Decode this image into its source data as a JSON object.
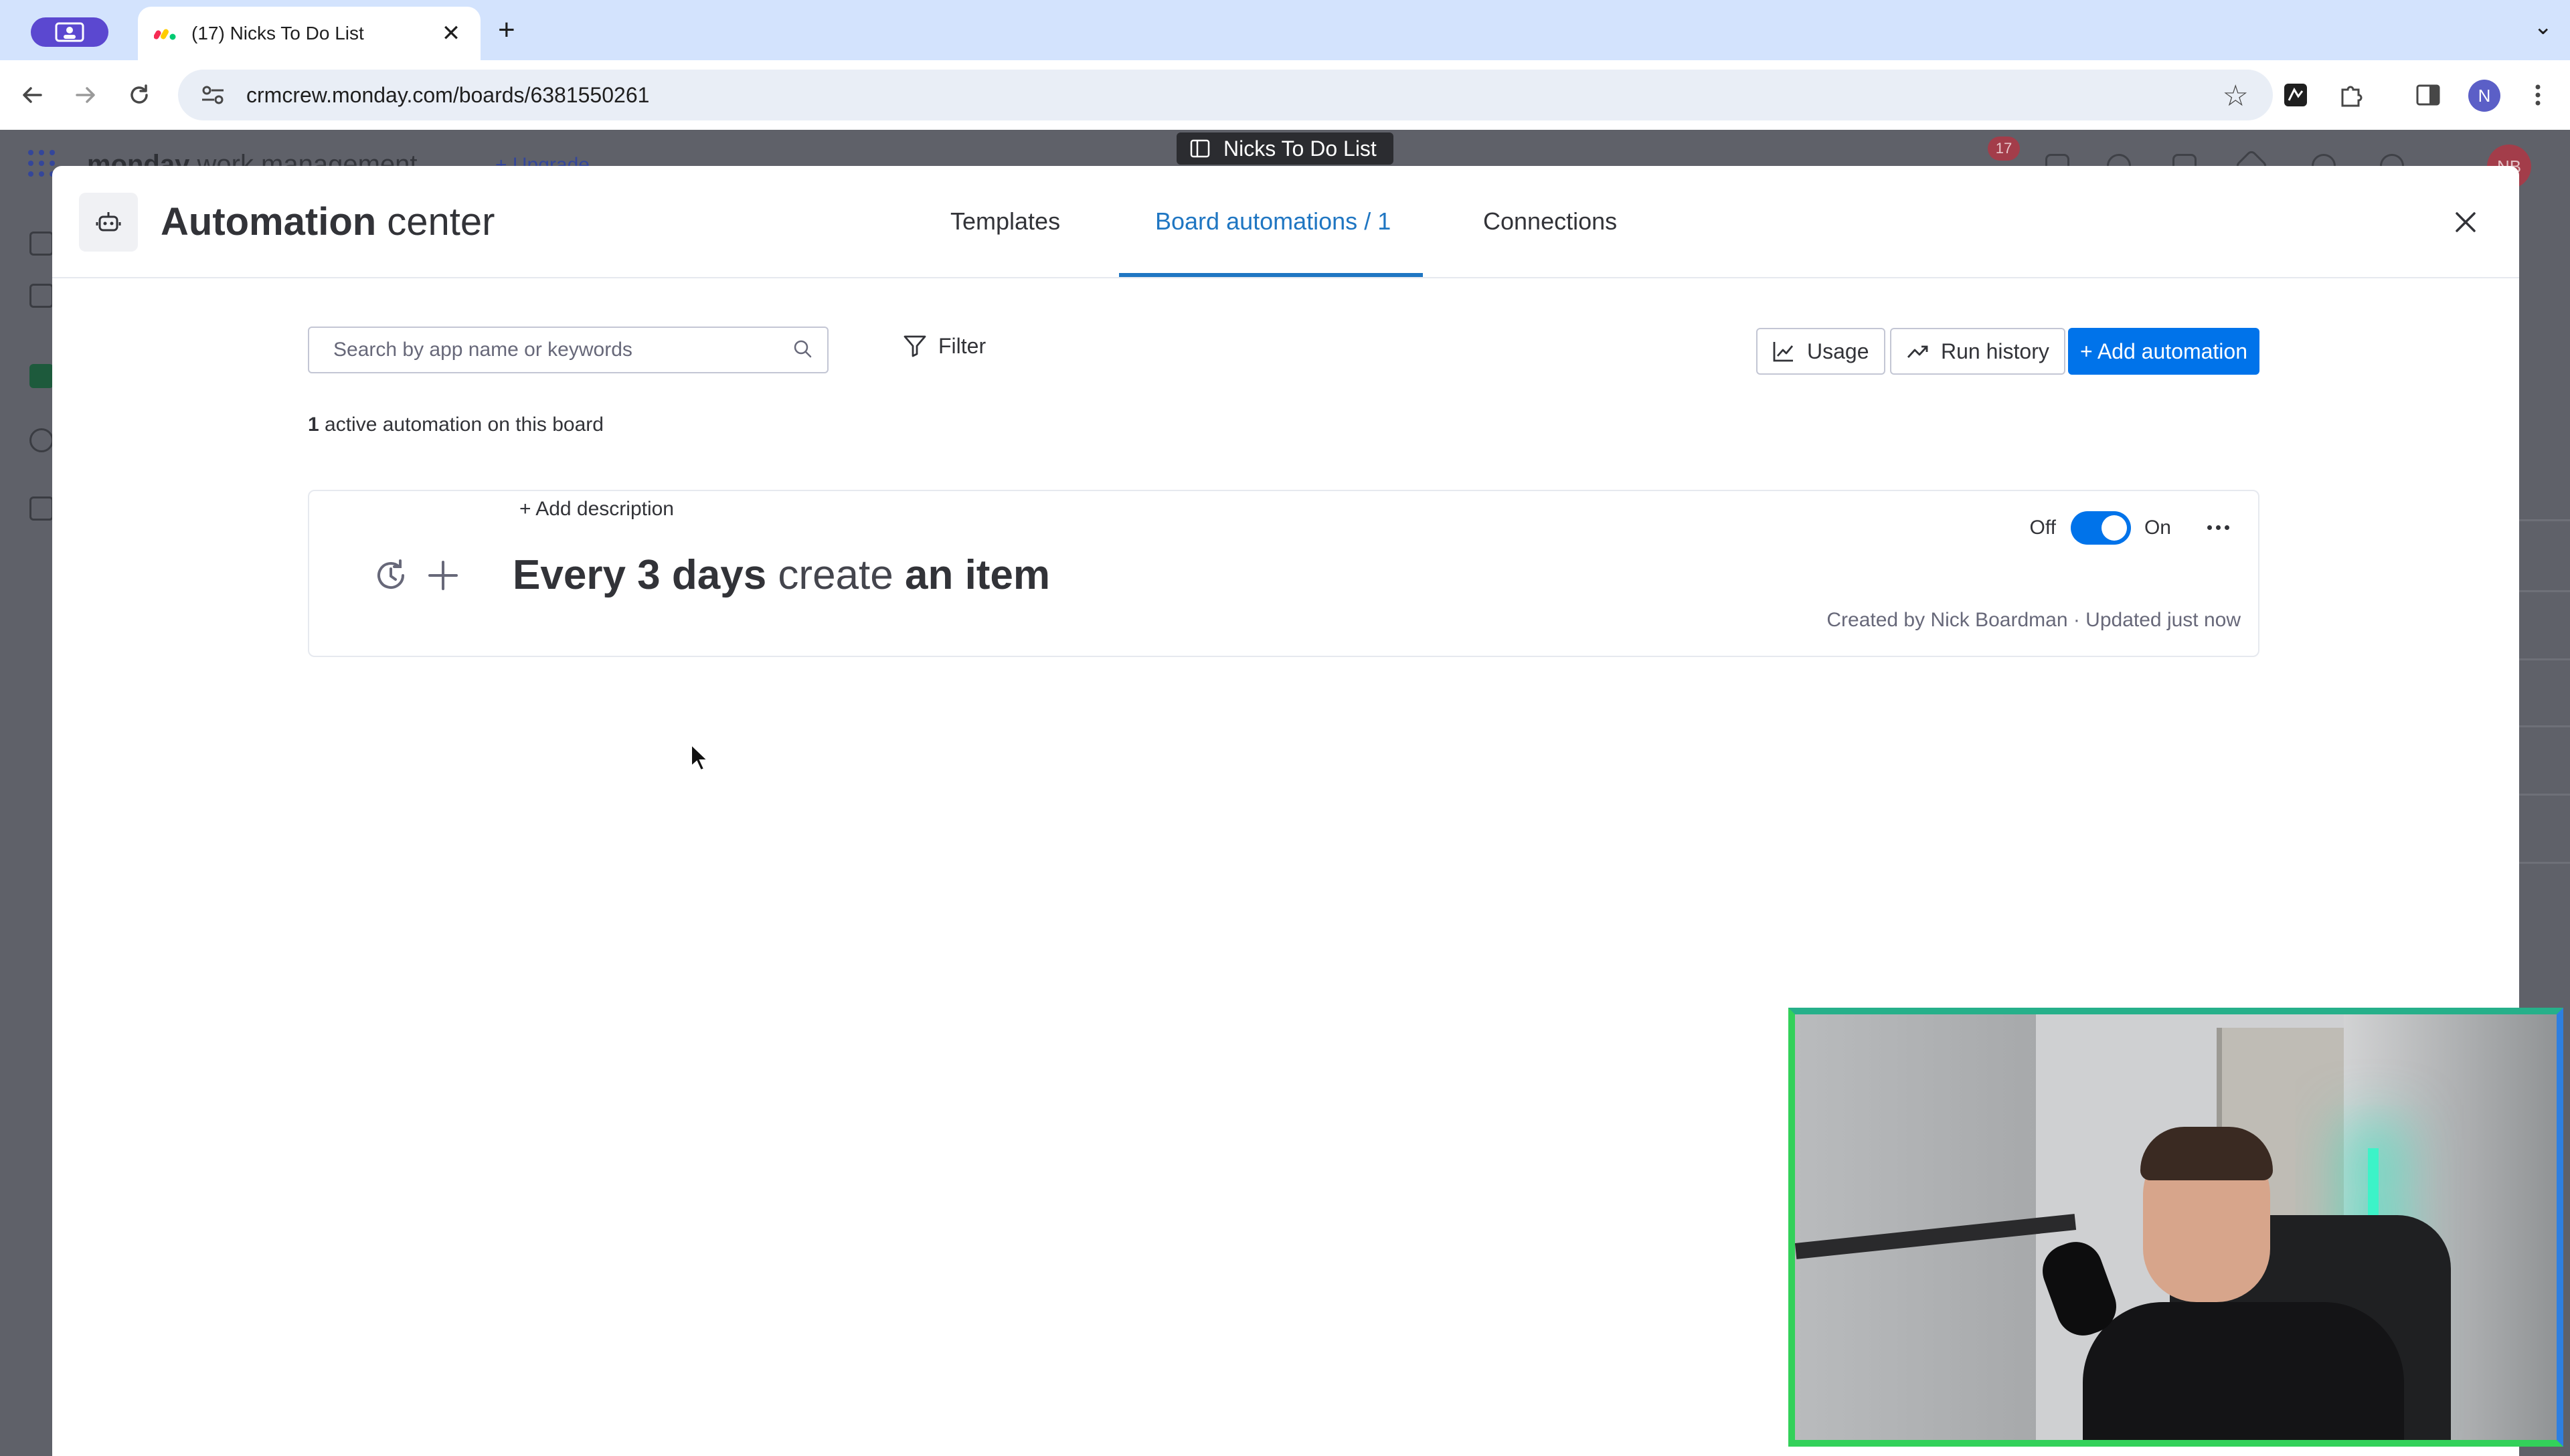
{
  "browser": {
    "tab_title": "(17) Nicks To Do List",
    "url": "crmcrew.monday.com/boards/6381550261",
    "profile_initial": "N"
  },
  "background_app": {
    "logo_brand": "monday",
    "logo_product": "work management",
    "upgrade_label": "+ Upgrade",
    "notification_count": "17",
    "user_initials": "NB",
    "board_chip": "Nicks To Do List"
  },
  "modal": {
    "title_bold": "Automation",
    "title_rest": "center",
    "tabs": [
      {
        "label": "Templates"
      },
      {
        "label": "Board automations / 1"
      },
      {
        "label": "Connections"
      }
    ],
    "search_placeholder": "Search by app name or keywords",
    "filter_label": "Filter",
    "usage_label": "Usage",
    "run_history_label": "Run history",
    "add_automation_label": "+ Add automation",
    "active_count": "1",
    "active_text": "active automation on this board"
  },
  "automation": {
    "add_description": "+ Add description",
    "trigger": "Every 3 days",
    "action_verb": "create",
    "action_object": "an item",
    "toggle_off": "Off",
    "toggle_on": "On",
    "enabled": true,
    "meta": "Created by Nick Boardman · Updated just now"
  },
  "colors": {
    "primary": "#0073ea",
    "active_tab": "#1f76c2",
    "text": "#323338",
    "muted": "#676879"
  }
}
